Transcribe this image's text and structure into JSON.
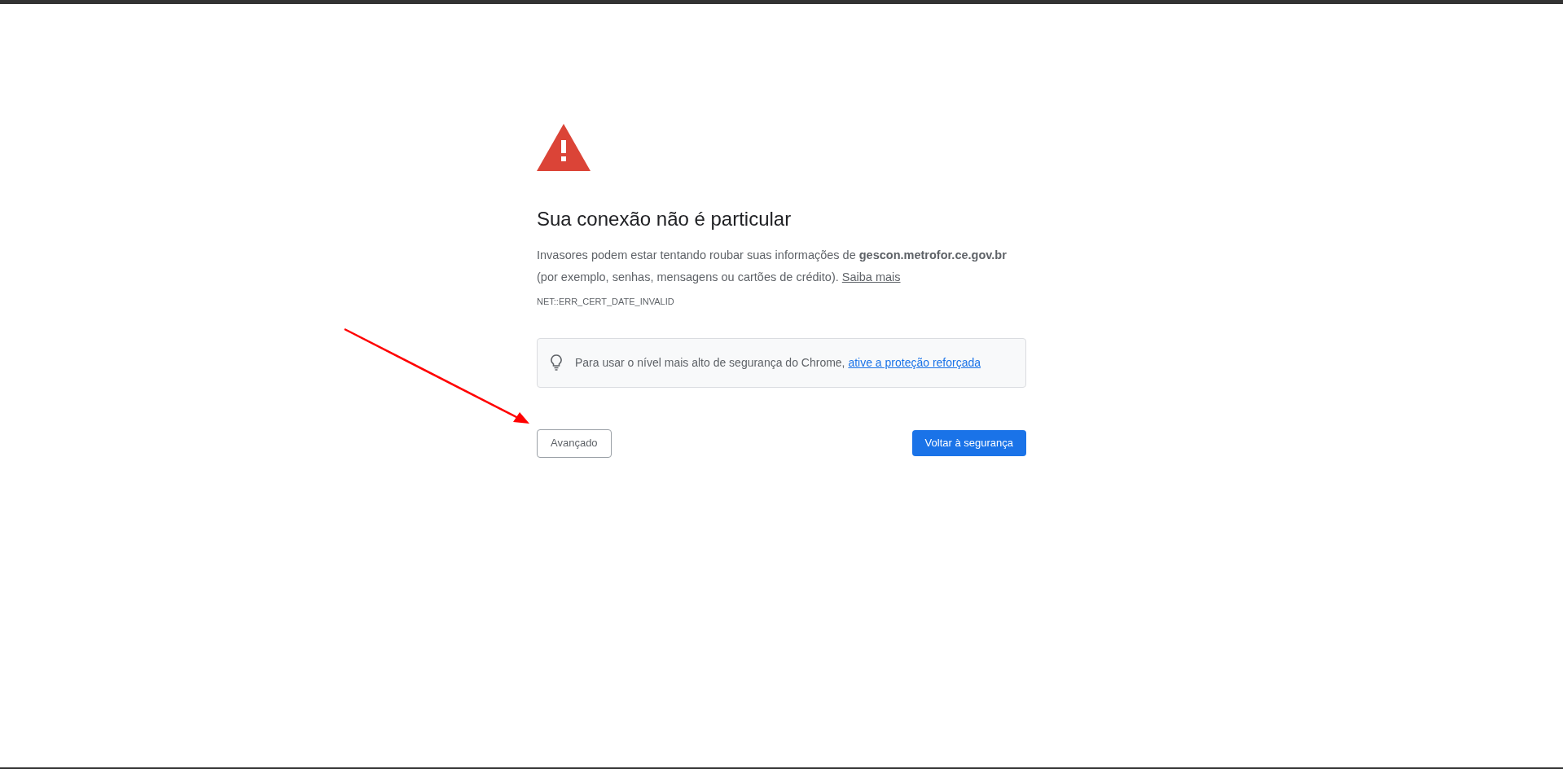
{
  "title": "Sua conexão não é particular",
  "message": {
    "text": "Invasores podem estar tentando roubar suas informações de **gescon.metrofor.ce.gov.br** (por exemplo, senhas, mensagens ou cartões de crédito).",
    "link": "Saiba mais"
  },
  "error_code": "NET::ERR_CERT_DATE_INVALID",
  "tip": {
    "text": "Para usar o nível mais alto de segurança do Chrome,",
    "link": "ative a proteção reforçada"
  },
  "buttons": [
    {
      "label": "Avançado",
      "kind": "secondary"
    },
    {
      "label": "Voltar à segurança",
      "kind": "primary"
    }
  ]
}
